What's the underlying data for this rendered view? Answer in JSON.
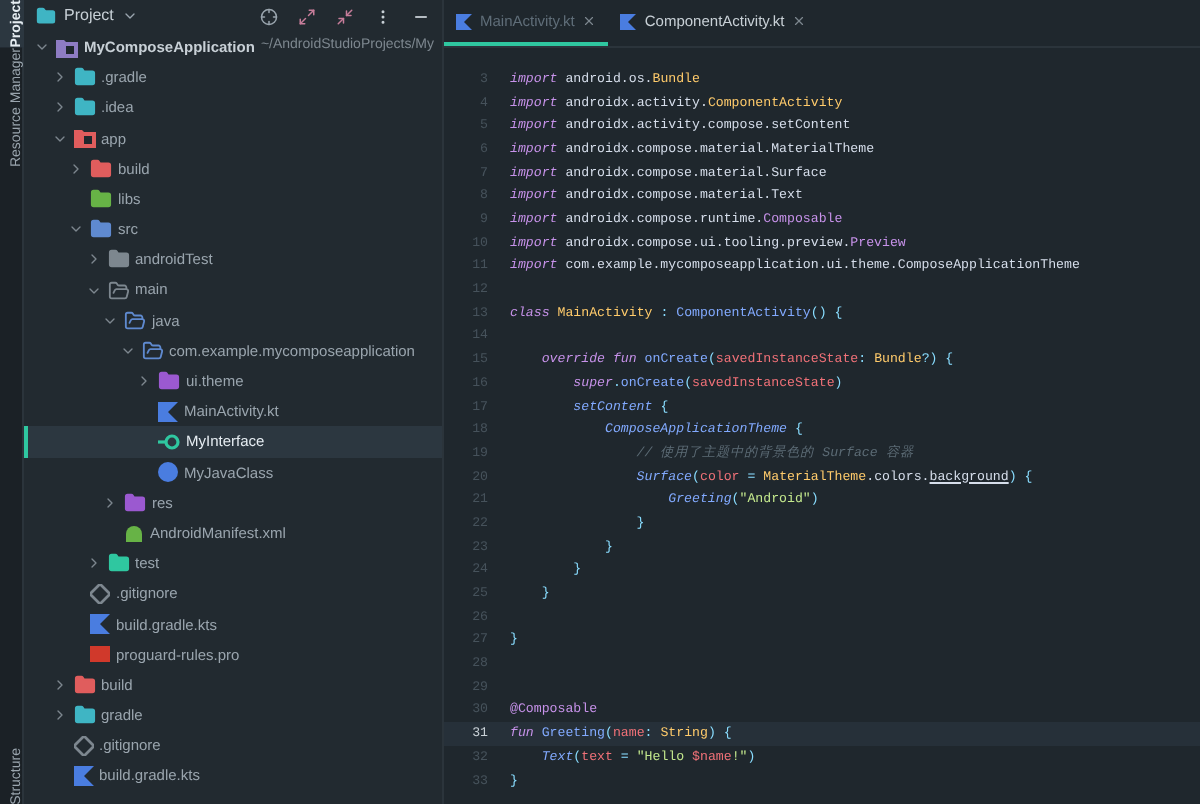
{
  "tool_strip": {
    "top": [
      {
        "label": "Project",
        "selected": true
      },
      {
        "label": "Resource Manager",
        "selected": false
      }
    ],
    "bottom": [
      {
        "label": "Structure",
        "selected": false
      }
    ]
  },
  "project_panel": {
    "title": "Project",
    "tree": [
      {
        "name": "MyComposeApplication",
        "path": "~/AndroidStudioProjects/My",
        "kind": "module",
        "color": "#8e7cc3",
        "expanded": true,
        "selected": false,
        "children": [
          {
            "name": ".gradle",
            "kind": "folder",
            "color": "#3fb5c4",
            "expanded": false,
            "selected": false
          },
          {
            "name": ".idea",
            "kind": "folder",
            "color": "#3fb5c4",
            "expanded": false,
            "selected": false
          },
          {
            "name": "app",
            "kind": "module",
            "color": "#e05d5d",
            "expanded": true,
            "selected": false,
            "children": [
              {
                "name": "build",
                "kind": "folder",
                "color": "#e05d5d",
                "expanded": false,
                "selected": false
              },
              {
                "name": "libs",
                "kind": "folder",
                "color": "#67b346",
                "selected": false
              },
              {
                "name": "src",
                "kind": "folder",
                "color": "#5f8ad0",
                "expanded": true,
                "selected": false,
                "children": [
                  {
                    "name": "androidTest",
                    "kind": "folder",
                    "color": "#7d878f",
                    "expanded": false,
                    "selected": false
                  },
                  {
                    "name": "main",
                    "kind": "folder-outline",
                    "color": "#7d878f",
                    "expanded": true,
                    "selected": false,
                    "children": [
                      {
                        "name": "java",
                        "kind": "folder-outline",
                        "color": "#5f8ad0",
                        "expanded": true,
                        "selected": false,
                        "children": [
                          {
                            "name": "com.example.mycomposeapplication",
                            "kind": "folder-outline",
                            "color": "#5f8ad0",
                            "expanded": true,
                            "selected": false,
                            "children": [
                              {
                                "name": "ui.theme",
                                "kind": "folder",
                                "color": "#9b59d0",
                                "expanded": false,
                                "selected": false
                              },
                              {
                                "name": "MainActivity.kt",
                                "kind": "kotlin",
                                "color": "#4a7de0",
                                "selected": false
                              },
                              {
                                "name": "MyInterface",
                                "kind": "interface",
                                "color": "#2fc7a0",
                                "selected": true
                              },
                              {
                                "name": "MyJavaClass",
                                "kind": "java",
                                "color": "#4a7de0",
                                "selected": false
                              }
                            ]
                          }
                        ]
                      },
                      {
                        "name": "res",
                        "kind": "folder",
                        "color": "#9b59d0",
                        "expanded": false,
                        "selected": false
                      },
                      {
                        "name": "AndroidManifest.xml",
                        "kind": "manifest",
                        "color": "#67b346",
                        "selected": false
                      }
                    ]
                  },
                  {
                    "name": "test",
                    "kind": "folder",
                    "color": "#2fc7a0",
                    "expanded": false,
                    "selected": false
                  }
                ]
              },
              {
                "name": ".gitignore",
                "kind": "gitignore",
                "color": "#7d878f",
                "selected": false
              },
              {
                "name": "build.gradle.kts",
                "kind": "kotlin",
                "color": "#4a7de0",
                "selected": false
              },
              {
                "name": "proguard-rules.pro",
                "kind": "proguard",
                "color": "#d0392b",
                "selected": false
              }
            ]
          },
          {
            "name": "build",
            "kind": "folder",
            "color": "#e05d5d",
            "expanded": false,
            "selected": false
          },
          {
            "name": "gradle",
            "kind": "folder",
            "color": "#3fb5c4",
            "expanded": false,
            "selected": false
          },
          {
            "name": ".gitignore",
            "kind": "gitignore",
            "color": "#7d878f",
            "selected": false
          },
          {
            "name": "build.gradle.kts",
            "kind": "kotlin",
            "color": "#4a7de0",
            "selected": false
          }
        ]
      }
    ]
  },
  "editor": {
    "tabs": [
      {
        "label": "MainActivity.kt",
        "selected": true
      },
      {
        "label": "ComponentActivity.kt",
        "selected": false
      }
    ],
    "lines": [
      {
        "number": "3",
        "current": false,
        "tokens": [
          {
            "kind": "kw",
            "text": "import "
          },
          {
            "kind": "plain",
            "text": "android.os."
          },
          {
            "kind": "type",
            "text": "Bundle"
          }
        ]
      },
      {
        "number": "4",
        "current": false,
        "tokens": [
          {
            "kind": "kw",
            "text": "import "
          },
          {
            "kind": "plain",
            "text": "androidx.activity."
          },
          {
            "kind": "type",
            "text": "ComponentActivity"
          }
        ]
      },
      {
        "number": "5",
        "current": false,
        "tokens": [
          {
            "kind": "kw",
            "text": "import "
          },
          {
            "kind": "plain",
            "text": "androidx.activity.compose.setContent"
          }
        ]
      },
      {
        "number": "6",
        "current": false,
        "tokens": [
          {
            "kind": "kw",
            "text": "import "
          },
          {
            "kind": "plain",
            "text": "androidx.compose.material.MaterialTheme"
          }
        ]
      },
      {
        "number": "7",
        "current": false,
        "tokens": [
          {
            "kind": "kw",
            "text": "import "
          },
          {
            "kind": "plain",
            "text": "androidx.compose.material.Surface"
          }
        ]
      },
      {
        "number": "8",
        "current": false,
        "tokens": [
          {
            "kind": "kw",
            "text": "import "
          },
          {
            "kind": "plain",
            "text": "androidx.compose.material.Text"
          }
        ]
      },
      {
        "number": "9",
        "current": false,
        "tokens": [
          {
            "kind": "kw",
            "text": "import "
          },
          {
            "kind": "plain",
            "text": "androidx.compose.runtime."
          },
          {
            "kind": "annot",
            "text": "Composable"
          }
        ]
      },
      {
        "number": "10",
        "current": false,
        "tokens": [
          {
            "kind": "kw",
            "text": "import "
          },
          {
            "kind": "plain",
            "text": "androidx.compose.ui.tooling.preview."
          },
          {
            "kind": "annot",
            "text": "Preview"
          }
        ]
      },
      {
        "number": "11",
        "current": false,
        "tokens": [
          {
            "kind": "kw",
            "text": "import "
          },
          {
            "kind": "plain",
            "text": "com.example.mycomposeapplication.ui.theme.ComposeApplicationTheme"
          }
        ]
      },
      {
        "number": "12",
        "current": false
      },
      {
        "number": "13",
        "current": false,
        "tokens": [
          {
            "kind": "kw",
            "text": "class "
          },
          {
            "kind": "type",
            "text": "MainActivity"
          },
          {
            "kind": "punct",
            "text": " : "
          },
          {
            "kind": "fn",
            "text": "ComponentActivity"
          },
          {
            "kind": "punct",
            "text": "() {"
          }
        ]
      },
      {
        "number": "14",
        "current": false
      },
      {
        "number": "15",
        "current": false,
        "tokens": [
          {
            "kind": "kw",
            "text": "    override fun "
          },
          {
            "kind": "fn",
            "text": "onCreate"
          },
          {
            "kind": "punct",
            "text": "("
          },
          {
            "kind": "param",
            "text": "savedInstanceState"
          },
          {
            "kind": "punct",
            "text": ": "
          },
          {
            "kind": "type",
            "text": "Bundle"
          },
          {
            "kind": "punct",
            "text": "?) {"
          }
        ]
      },
      {
        "number": "16",
        "current": false,
        "tokens": [
          {
            "kind": "kw",
            "text": "        super"
          },
          {
            "kind": "punct",
            "text": "."
          },
          {
            "kind": "fn",
            "text": "onCreate"
          },
          {
            "kind": "punct",
            "text": "("
          },
          {
            "kind": "param",
            "text": "savedInstanceState"
          },
          {
            "kind": "punct",
            "text": ")"
          }
        ]
      },
      {
        "number": "17",
        "current": false,
        "tokens": [
          {
            "kind": "call",
            "text": "        setContent"
          },
          {
            "kind": "punct",
            "text": " {"
          }
        ]
      },
      {
        "number": "18",
        "current": false,
        "tokens": [
          {
            "kind": "call",
            "text": "            ComposeApplicationTheme"
          },
          {
            "kind": "punct",
            "text": " {"
          }
        ]
      },
      {
        "number": "19",
        "current": false,
        "tokens": [
          {
            "kind": "comment",
            "text": "                // 使用了主题中的背景色的 Surface 容器"
          }
        ]
      },
      {
        "number": "20",
        "current": false,
        "tokens": [
          {
            "kind": "call",
            "text": "                Surface"
          },
          {
            "kind": "punct",
            "text": "("
          },
          {
            "kind": "param",
            "text": "color"
          },
          {
            "kind": "punct",
            "text": " = "
          },
          {
            "kind": "type",
            "text": "MaterialTheme"
          },
          {
            "kind": "plain",
            "text": ".colors."
          },
          {
            "kind": "prop",
            "text": "background"
          },
          {
            "kind": "punct",
            "text": ") {"
          }
        ]
      },
      {
        "number": "21",
        "current": false,
        "tokens": [
          {
            "kind": "call",
            "text": "                    Greeting"
          },
          {
            "kind": "punct",
            "text": "("
          },
          {
            "kind": "str",
            "text": "\"Android\""
          },
          {
            "kind": "punct",
            "text": ")"
          }
        ]
      },
      {
        "number": "22",
        "current": false,
        "tokens": [
          {
            "kind": "punct",
            "text": "                }"
          }
        ]
      },
      {
        "number": "23",
        "current": false,
        "tokens": [
          {
            "kind": "punct",
            "text": "            }"
          }
        ]
      },
      {
        "number": "24",
        "current": false,
        "tokens": [
          {
            "kind": "punct",
            "text": "        }"
          }
        ]
      },
      {
        "number": "25",
        "current": false,
        "tokens": [
          {
            "kind": "punct",
            "text": "    }"
          }
        ]
      },
      {
        "number": "26",
        "current": false
      },
      {
        "number": "27",
        "current": false,
        "tokens": [
          {
            "kind": "punct",
            "text": "}"
          }
        ]
      },
      {
        "number": "28",
        "current": false
      },
      {
        "number": "29",
        "current": false
      },
      {
        "number": "30",
        "current": false,
        "tokens": [
          {
            "kind": "annot",
            "text": "@Composable"
          }
        ]
      },
      {
        "number": "31",
        "current": true,
        "tokens": [
          {
            "kind": "kw",
            "text": "fun "
          },
          {
            "kind": "fn",
            "text": "Greeting"
          },
          {
            "kind": "punct",
            "text": "("
          },
          {
            "kind": "param",
            "text": "name"
          },
          {
            "kind": "punct",
            "text": ": "
          },
          {
            "kind": "type",
            "text": "String"
          },
          {
            "kind": "punct",
            "text": ") {"
          }
        ]
      },
      {
        "number": "32",
        "current": false,
        "tokens": [
          {
            "kind": "call",
            "text": "    Text"
          },
          {
            "kind": "punct",
            "text": "("
          },
          {
            "kind": "param",
            "text": "text"
          },
          {
            "kind": "punct",
            "text": " = "
          },
          {
            "kind": "str",
            "text": "\"Hello "
          },
          {
            "kind": "param",
            "text": "$name"
          },
          {
            "kind": "str",
            "text": "!\""
          },
          {
            "kind": "punct",
            "text": ")"
          }
        ]
      },
      {
        "number": "33",
        "current": false,
        "tokens": [
          {
            "kind": "punct",
            "text": "}"
          }
        ]
      }
    ]
  }
}
